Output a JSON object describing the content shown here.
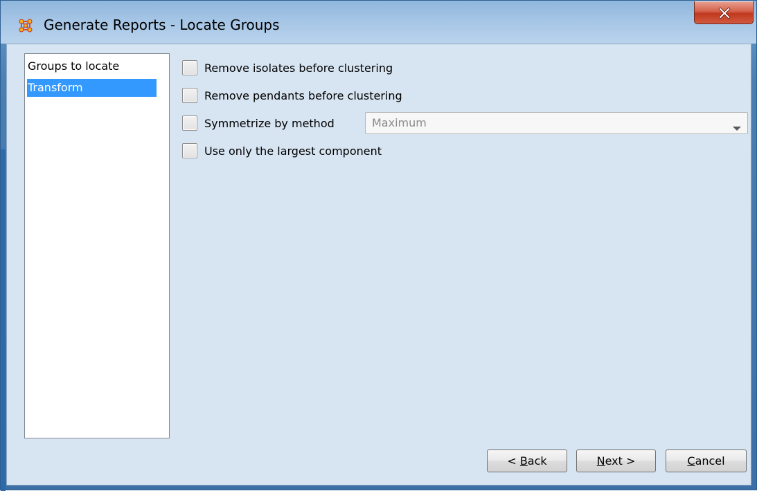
{
  "window": {
    "title": "Generate Reports - Locate Groups",
    "icon": "network-grid-icon",
    "close_icon": "close-x-icon"
  },
  "sidebar": {
    "items": [
      {
        "label": "Groups to locate",
        "selected": false
      },
      {
        "label": "Transform",
        "selected": true
      }
    ]
  },
  "options": [
    {
      "label": "Remove isolates before clustering",
      "checked": false
    },
    {
      "label": "Remove pendants before clustering",
      "checked": false
    },
    {
      "label": "Symmetrize by method",
      "checked": false
    },
    {
      "label": "Use only the largest component",
      "checked": false
    }
  ],
  "symmetrize_method": {
    "value": "Maximum",
    "enabled": false
  },
  "buttons": {
    "back": {
      "prefix": "< ",
      "mnemonic": "B",
      "rest": "ack"
    },
    "next": {
      "mnemonic": "N",
      "rest": "ext >"
    },
    "cancel": {
      "mnemonic": "C",
      "rest": "ancel"
    }
  },
  "colors": {
    "selection": "#3399ff",
    "client_bg": "#d7e4f2",
    "close_button": "#c7432a"
  }
}
